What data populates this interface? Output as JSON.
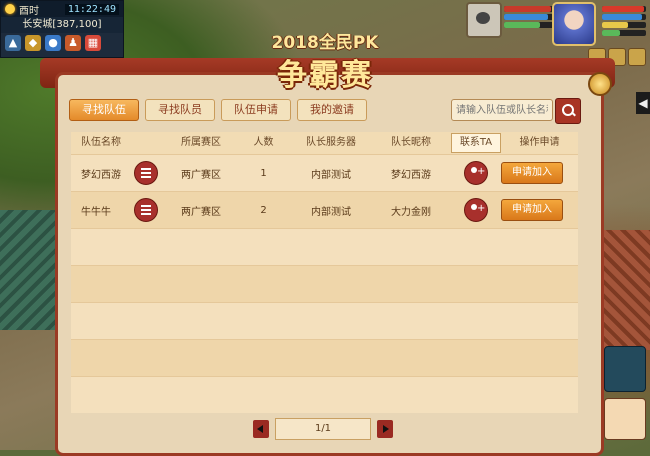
{
  "hud": {
    "period": "酉时",
    "clock": "11:22:49",
    "location": "长安城[387,100]"
  },
  "event": {
    "year_label": "2018全民PK",
    "title": "争霸赛"
  },
  "tabs": [
    {
      "label": "寻找队伍",
      "active": true
    },
    {
      "label": "寻找队员",
      "active": false
    },
    {
      "label": "队伍申请",
      "active": false
    },
    {
      "label": "我的邀请",
      "active": false
    }
  ],
  "search": {
    "placeholder": "请输入队伍或队长名称"
  },
  "table": {
    "headers": [
      "队伍名称",
      "所属赛区",
      "人数",
      "队长服务器",
      "队长昵称",
      "联系TA",
      "操作申请"
    ],
    "rows": [
      {
        "team": "梦幻西游",
        "region": "两广赛区",
        "count": "1",
        "server": "内部测试",
        "leader": "梦幻西游",
        "action": "申请加入"
      },
      {
        "team": "牛牛牛",
        "region": "两广赛区",
        "count": "2",
        "server": "内部测试",
        "leader": "大力金刚",
        "action": "申请加入"
      }
    ],
    "empty_rows": 5
  },
  "pager": {
    "label": "1/1"
  },
  "colors": {
    "accent": "#a8302c",
    "apply": "#e48a2a",
    "panel": "#e8d6b6"
  }
}
